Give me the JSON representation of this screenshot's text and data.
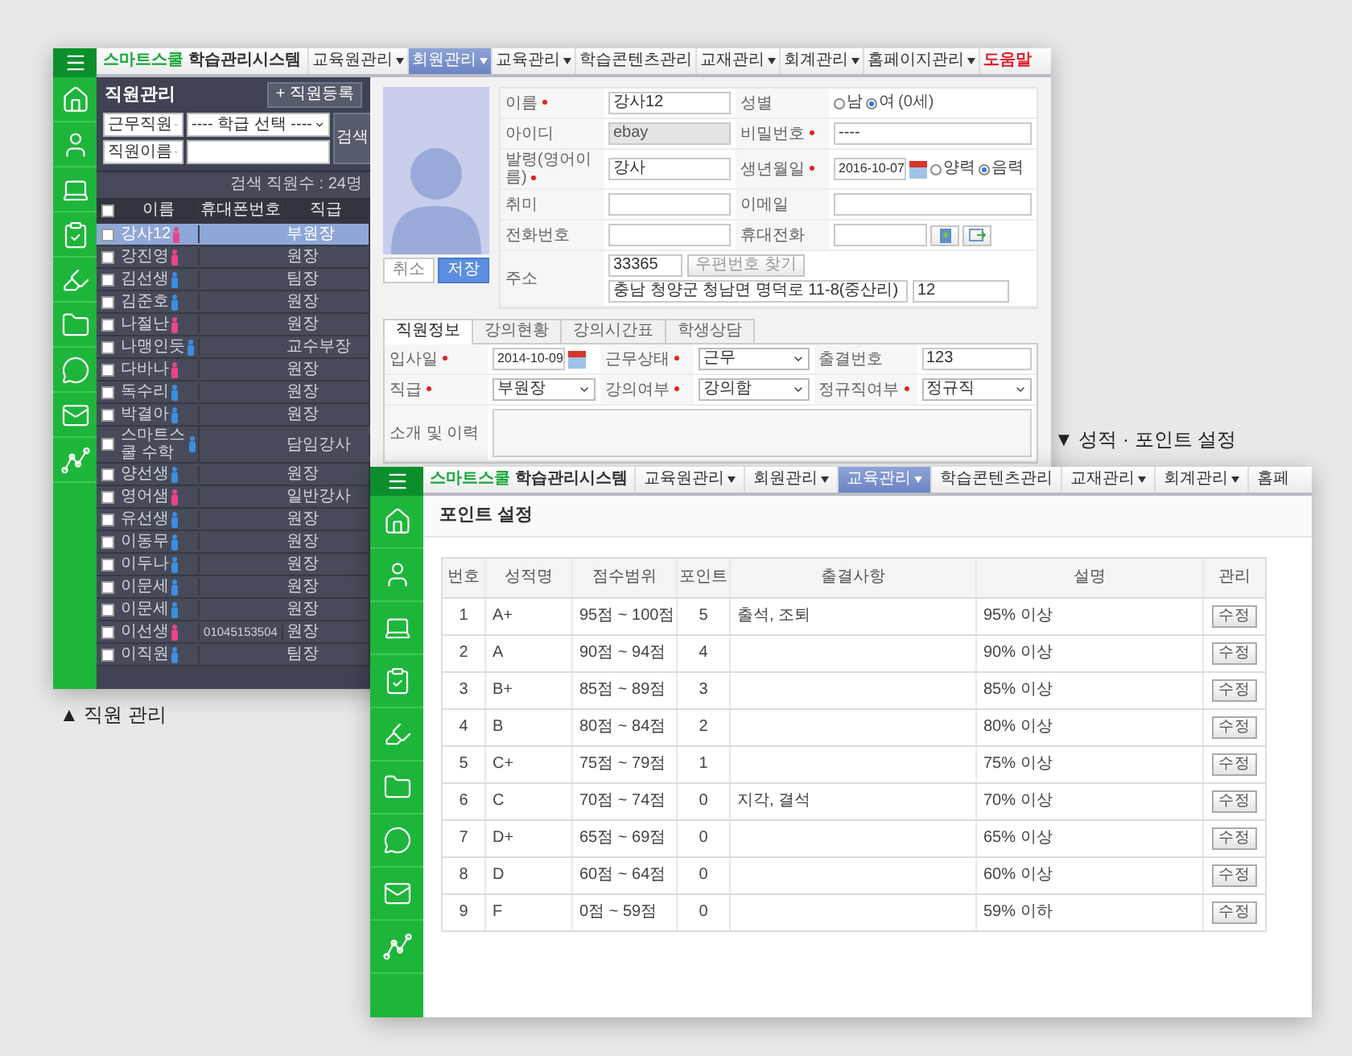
{
  "staff_window": {
    "caption": "▲ 직원 관리",
    "nav": {
      "brand_highlight": "스마트스쿨",
      "brand_rest": "학습관리시스템",
      "items": [
        {
          "label": "교육원관리",
          "kind": "menu",
          "dropdown": true,
          "selected": false
        },
        {
          "label": "회원관리",
          "kind": "menu",
          "dropdown": true,
          "selected": true
        },
        {
          "label": "교육관리",
          "kind": "menu",
          "dropdown": true,
          "selected": false
        },
        {
          "label": "학습콘텐츠관리",
          "kind": "menu",
          "dropdown": false,
          "selected": false
        },
        {
          "label": "교재관리",
          "kind": "menu",
          "dropdown": true,
          "selected": false
        },
        {
          "label": "회계관리",
          "kind": "menu",
          "dropdown": true,
          "selected": false
        },
        {
          "label": "홈페이지관리",
          "kind": "menu",
          "dropdown": true,
          "selected": false
        },
        {
          "label": "도움말",
          "kind": "help",
          "dropdown": false,
          "selected": false
        }
      ]
    },
    "staff_panel": {
      "title": "직원관리",
      "add_button": "+ 직원등록",
      "filters": {
        "status_select": "근무직원",
        "class_select": "---- 학급 선택 ----",
        "field_select": "직원이름",
        "search_button": "검색"
      },
      "count": "검색 직원수 : 24명",
      "header_checked": false,
      "columns": [
        "이름",
        "휴대폰번호",
        "직급"
      ],
      "rows": [
        {
          "name": "강사12",
          "color": "#e8458b",
          "rank": "부원장",
          "checked": false,
          "selected": true
        },
        {
          "name": "강진영",
          "color": "#e8458b",
          "rank": "원장",
          "checked": false,
          "selected": false
        },
        {
          "name": "김선생",
          "color": "#3d8de0",
          "rank": "팀장",
          "checked": false,
          "selected": false
        },
        {
          "name": "김준호",
          "color": "#3d8de0",
          "rank": "원장",
          "checked": false,
          "selected": false
        },
        {
          "name": "나절난",
          "color": "#e8458b",
          "rank": "원장",
          "checked": false,
          "selected": false
        },
        {
          "name": "나맹인듯",
          "color": "#3d8de0",
          "rank": "교수부장",
          "checked": false,
          "selected": false
        },
        {
          "name": "다바나",
          "color": "#e8458b",
          "rank": "원장",
          "checked": false,
          "selected": false
        },
        {
          "name": "독수리",
          "color": "#3d8de0",
          "rank": "원장",
          "checked": false,
          "selected": false
        },
        {
          "name": "박결아",
          "color": "#3d8de0",
          "rank": "원장",
          "checked": false,
          "selected": false
        },
        {
          "name": "스마트스쿨 수학",
          "color": "#3d8de0",
          "rank": "담임강사",
          "checked": false,
          "selected": false
        },
        {
          "name": "양선생",
          "color": "#3d8de0",
          "rank": "원장",
          "checked": false,
          "selected": false
        },
        {
          "name": "영어샘",
          "color": "#e8458b",
          "rank": "일반강사",
          "checked": false,
          "selected": false
        },
        {
          "name": "유선생",
          "color": "#3d8de0",
          "rank": "원장",
          "checked": false,
          "selected": false
        },
        {
          "name": "이동무",
          "color": "#3d8de0",
          "rank": "원장",
          "checked": false,
          "selected": false
        },
        {
          "name": "이두나",
          "color": "#3d8de0",
          "rank": "원장",
          "checked": false,
          "selected": false
        },
        {
          "name": "이문세",
          "color": "#3d8de0",
          "rank": "원장",
          "checked": false,
          "selected": false
        },
        {
          "name": "이문세",
          "color": "#3d8de0",
          "rank": "원장",
          "checked": false,
          "selected": false
        },
        {
          "name": "이선생",
          "color": "#e8458b",
          "phone": "01045153504",
          "rank": "원장",
          "checked": false,
          "selected": false
        },
        {
          "name": "이직원",
          "color": "#3d8de0",
          "rank": "팀장",
          "checked": false,
          "selected": false
        }
      ]
    },
    "profile": {
      "cancel_button": "취소",
      "save_button": "저장",
      "fields": [
        {
          "kind": "text",
          "label": "이름",
          "required": true,
          "disabled": false,
          "value": "강사12"
        },
        {
          "kind": "radio",
          "label": "성별",
          "required": false,
          "options": [
            {
              "label": "남",
              "selected": false
            },
            {
              "label": "여",
              "selected": true
            }
          ],
          "note": "(0세)"
        },
        {
          "kind": "text",
          "label": "아이디",
          "required": false,
          "disabled": true,
          "value": "ebay"
        },
        {
          "kind": "text",
          "label": "비밀번호",
          "required": true,
          "disabled": false,
          "value": "----"
        },
        {
          "kind": "text",
          "label": "발령(영어이름)",
          "required": true,
          "disabled": false,
          "value": "강사"
        },
        {
          "kind": "date",
          "label": "생년월일",
          "required": true,
          "value": "2016-10-07",
          "options": [
            {
              "label": "양력",
              "selected": false
            },
            {
              "label": "음력",
              "selected": true
            }
          ]
        },
        {
          "kind": "text",
          "label": "취미",
          "required": false,
          "disabled": false
        },
        {
          "kind": "text",
          "label": "이메일",
          "required": false,
          "disabled": false
        },
        {
          "kind": "text",
          "label": "전화번호",
          "required": false,
          "disabled": false
        },
        {
          "kind": "phone",
          "label": "휴대전화",
          "required": false
        },
        {
          "kind": "address",
          "label": "주소",
          "required": false,
          "zip": "33365",
          "zip_button": "우편번호 찾기",
          "address": "충남 청양군 청남면 명덕로 11-8(중산리)",
          "detail": "12"
        }
      ]
    },
    "detail_tabs": [
      {
        "label": "직원정보",
        "selected": true
      },
      {
        "label": "강의현황",
        "selected": false
      },
      {
        "label": "강의시간표",
        "selected": false
      },
      {
        "label": "학생상담",
        "selected": false
      }
    ],
    "detail_fields": [
      {
        "kind": "date",
        "label": "입사일",
        "required": true,
        "value": "2014-10-09"
      },
      {
        "kind": "select",
        "label": "근무상태",
        "required": true,
        "value": "근무"
      },
      {
        "kind": "text",
        "label": "출결번호",
        "required": false,
        "value": "123"
      },
      {
        "kind": "select",
        "label": "직급",
        "required": true,
        "value": "부원장"
      },
      {
        "kind": "select",
        "label": "강의여부",
        "required": true,
        "value": "강의함"
      },
      {
        "kind": "select",
        "label": "정규직여부",
        "required": true,
        "value": "정규직"
      },
      {
        "kind": "textarea",
        "label": "소개 및 이력",
        "required": false
      }
    ]
  },
  "points_window": {
    "caption": "▼ 성적 · 포인트 설정",
    "nav": {
      "brand_highlight": "스마트스쿨",
      "brand_rest": "학습관리시스템",
      "items": [
        {
          "label": "교육원관리",
          "kind": "menu",
          "dropdown": true,
          "selected": false
        },
        {
          "label": "회원관리",
          "kind": "menu",
          "dropdown": true,
          "selected": false
        },
        {
          "label": "교육관리",
          "kind": "menu",
          "dropdown": true,
          "selected": true
        },
        {
          "label": "학습콘텐츠관리",
          "kind": "menu",
          "dropdown": false,
          "selected": false
        },
        {
          "label": "교재관리",
          "kind": "menu",
          "dropdown": true,
          "selected": false
        },
        {
          "label": "회계관리",
          "kind": "menu",
          "dropdown": true,
          "selected": false
        },
        {
          "label": "홈페",
          "kind": "menu",
          "dropdown": false,
          "selected": false
        }
      ]
    },
    "page_title": "포인트 설정",
    "table": {
      "columns": [
        "번호",
        "성적명",
        "점수범위",
        "포인트",
        "출결사항",
        "설명",
        "관리"
      ],
      "rows": [
        {
          "no": "1",
          "grade": "A+",
          "range": "95점 ~ 100점",
          "points": "5",
          "attendance": "출석, 조퇴",
          "description": "95% 이상",
          "action": "수정"
        },
        {
          "no": "2",
          "grade": "A",
          "range": "90점 ~ 94점",
          "points": "4",
          "description": "90% 이상",
          "action": "수정"
        },
        {
          "no": "3",
          "grade": "B+",
          "range": "85점 ~ 89점",
          "points": "3",
          "description": "85% 이상",
          "action": "수정"
        },
        {
          "no": "4",
          "grade": "B",
          "range": "80점 ~ 84점",
          "points": "2",
          "description": "80% 이상",
          "action": "수정"
        },
        {
          "no": "5",
          "grade": "C+",
          "range": "75점 ~ 79점",
          "points": "1",
          "description": "75% 이상",
          "action": "수정"
        },
        {
          "no": "6",
          "grade": "C",
          "range": "70점 ~ 74점",
          "points": "0",
          "attendance": "지각, 결석",
          "description": "70% 이상",
          "action": "수정"
        },
        {
          "no": "7",
          "grade": "D+",
          "range": "65점 ~ 69점",
          "points": "0",
          "description": "65% 이상",
          "action": "수정"
        },
        {
          "no": "8",
          "grade": "D",
          "range": "60점 ~ 64점",
          "points": "0",
          "description": "60% 이상",
          "action": "수정"
        },
        {
          "no": "9",
          "grade": "F",
          "range": "0점 ~ 59점",
          "points": "0",
          "description": "59% 이하",
          "action": "수정"
        }
      ]
    }
  }
}
